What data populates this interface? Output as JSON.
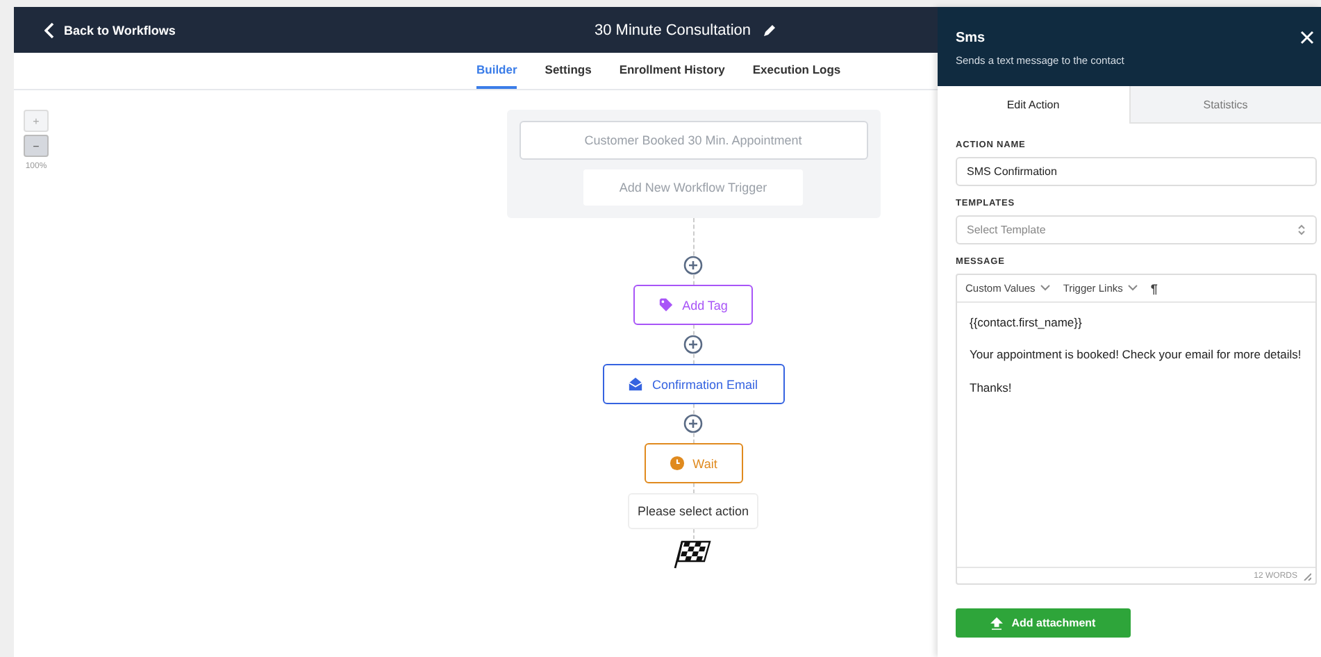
{
  "header": {
    "back_label": "Back to Workflows",
    "title": "30 Minute Consultation"
  },
  "tabs": [
    {
      "label": "Builder",
      "selected": true
    },
    {
      "label": "Settings",
      "selected": false
    },
    {
      "label": "Enrollment History",
      "selected": false
    },
    {
      "label": "Execution Logs",
      "selected": false
    }
  ],
  "zoom": {
    "plus": "+",
    "minus": "−",
    "percent": "100%"
  },
  "trigger": {
    "name": "Customer Booked 30 Min. Appointment",
    "add_label": "Add New Workflow Trigger"
  },
  "steps": [
    {
      "kind": "tag",
      "label": "Add Tag"
    },
    {
      "kind": "email",
      "label": "Confirmation Email"
    },
    {
      "kind": "wait",
      "label": "Wait"
    }
  ],
  "pending_action": "Please select action",
  "panel": {
    "title": "Sms",
    "subtitle": "Sends a text message to the contact",
    "tabs": [
      {
        "label": "Edit Action",
        "selected": true
      },
      {
        "label": "Statistics",
        "selected": false
      }
    ],
    "action_name_label": "ACTION NAME",
    "action_name": "SMS Confirmation",
    "templates_label": "TEMPLATES",
    "templates_placeholder": "Select Template",
    "message_label": "MESSAGE",
    "toolbar": [
      "Custom Values",
      "Trigger Links"
    ],
    "paragraph_glyph": "¶",
    "message_lines": [
      "{{contact.first_name}}",
      "Your appointment is booked! Check your email for more details!",
      "Thanks!"
    ],
    "word_count": "12 WORDS",
    "attach_label": "Add attachment"
  }
}
